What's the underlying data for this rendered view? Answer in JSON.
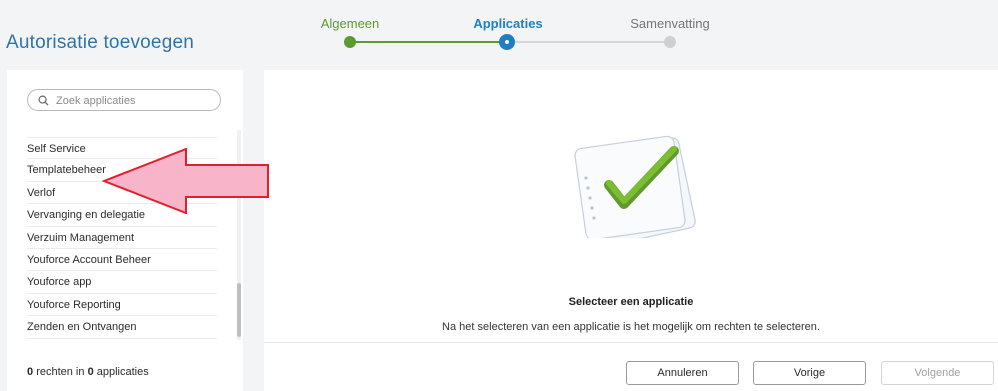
{
  "page": {
    "title": "Autorisatie toevoegen"
  },
  "stepper": {
    "steps": [
      {
        "label": "Algemeen",
        "state": "done"
      },
      {
        "label": "Applicaties",
        "state": "active"
      },
      {
        "label": "Samenvatting",
        "state": "todo"
      }
    ],
    "colors": {
      "done": "#5a9b2f",
      "active": "#1f7fc4",
      "todo": "#d0d0d0"
    }
  },
  "search": {
    "placeholder": "Zoek applicaties",
    "value": ""
  },
  "app_list": {
    "items": [
      "Self Service",
      "Templatebeheer",
      "Verlof",
      "Vervanging en delegatie",
      "Verzuim Management",
      "Youforce Account Beheer",
      "Youforce app",
      "Youforce Reporting",
      "Zenden en Ontvangen"
    ]
  },
  "summary": {
    "rights_count": "0",
    "rights_text": "rechten in",
    "apps_count": "0",
    "apps_text": "applicaties"
  },
  "main": {
    "empty_title": "Selecteer een applicatie",
    "empty_text": "Na het selecteren van een applicatie is het mogelijk om rechten te selecteren.",
    "illustration_icon": "document-checkmark-icon",
    "check_color": "#6aa52b"
  },
  "footer": {
    "cancel_label": "Annuleren",
    "previous_label": "Vorige",
    "next_label": "Volgende",
    "next_enabled": false
  },
  "annotation": {
    "icon": "left-arrow-icon",
    "fill": "#f8b4c8",
    "stroke": "#e0202a"
  }
}
